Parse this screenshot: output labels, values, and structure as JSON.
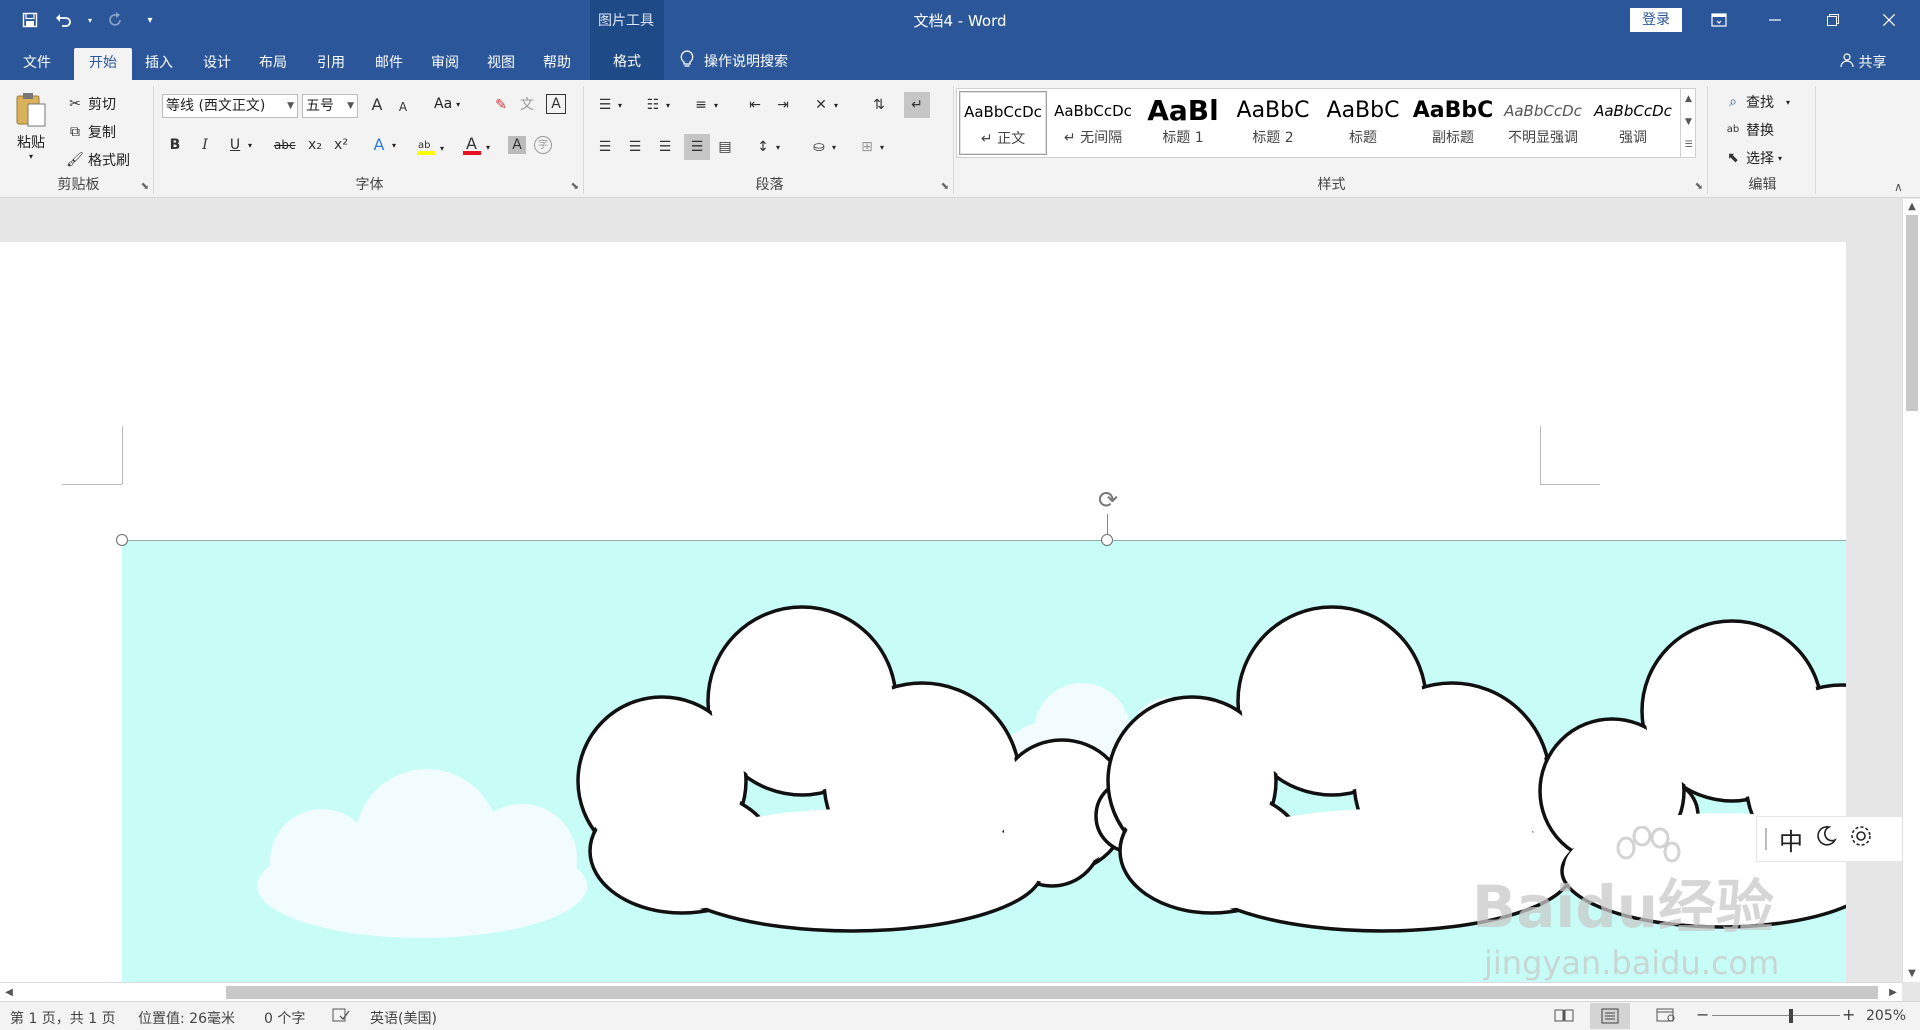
{
  "titlebar": {
    "doc_title": "文档4 - Word",
    "picture_tools": "图片工具",
    "login_label": "登录",
    "qat_icons": [
      "save-icon",
      "undo-icon",
      "redo-icon",
      "customize-icon"
    ],
    "window_icons": [
      "ribbon-display-icon",
      "minimize-icon",
      "restore-icon",
      "close-icon"
    ]
  },
  "menubar": {
    "tabs": [
      "文件",
      "开始",
      "插入",
      "设计",
      "布局",
      "引用",
      "邮件",
      "审阅",
      "视图",
      "帮助",
      "格式"
    ],
    "active_tab": "开始",
    "tell_me": "操作说明搜索",
    "share": "共享"
  },
  "ribbon": {
    "clipboard": {
      "label": "剪贴板",
      "paste": "粘贴",
      "cut": "剪切",
      "copy": "复制",
      "format_painter": "格式刷"
    },
    "font": {
      "label": "字体",
      "font_name": "等线 (西文正文)",
      "font_size": "五号",
      "bold": "B",
      "italic": "I",
      "underline": "U",
      "strike": "abc",
      "sub": "x₂",
      "sup": "x²",
      "grow": "A",
      "shrink": "A",
      "change_case": "Aa",
      "phonetic": "文",
      "char_border": "A",
      "font_color": "A",
      "char_shading": "A",
      "enclose": "字",
      "font_color_value": "#e81123",
      "highlight_color_value": "#ffff00"
    },
    "paragraph": {
      "label": "段落"
    },
    "styles": {
      "label": "样式",
      "items": [
        {
          "sample": "AaBbCcDc",
          "name": "↵ 正文"
        },
        {
          "sample": "AaBbCcDc",
          "name": "↵ 无间隔"
        },
        {
          "sample": "AaBl",
          "name": "标题 1"
        },
        {
          "sample": "AaBbC",
          "name": "标题 2"
        },
        {
          "sample": "AaBbC",
          "name": "标题"
        },
        {
          "sample": "AaBbC",
          "name": "副标题"
        },
        {
          "sample": "AaBbCcDc",
          "name": "不明显强调"
        },
        {
          "sample": "AaBbCcDc",
          "name": "强调"
        }
      ]
    },
    "editing": {
      "label": "编辑",
      "find": "查找",
      "replace": "替换",
      "select": "选择"
    }
  },
  "ime": {
    "mode": "中"
  },
  "watermark": {
    "logo": "Baidu经验",
    "url": "jingyan.baidu.com"
  },
  "statusbar": {
    "page": "第 1 页，共 1 页",
    "position": "位置值: 26毫米",
    "words": "0 个字",
    "language": "英语(美国)",
    "zoom": "205%",
    "zoom_minus": "−",
    "zoom_plus": "+"
  },
  "colors": {
    "brand": "#2b579a",
    "picture_bg": "#c8fdf7"
  }
}
